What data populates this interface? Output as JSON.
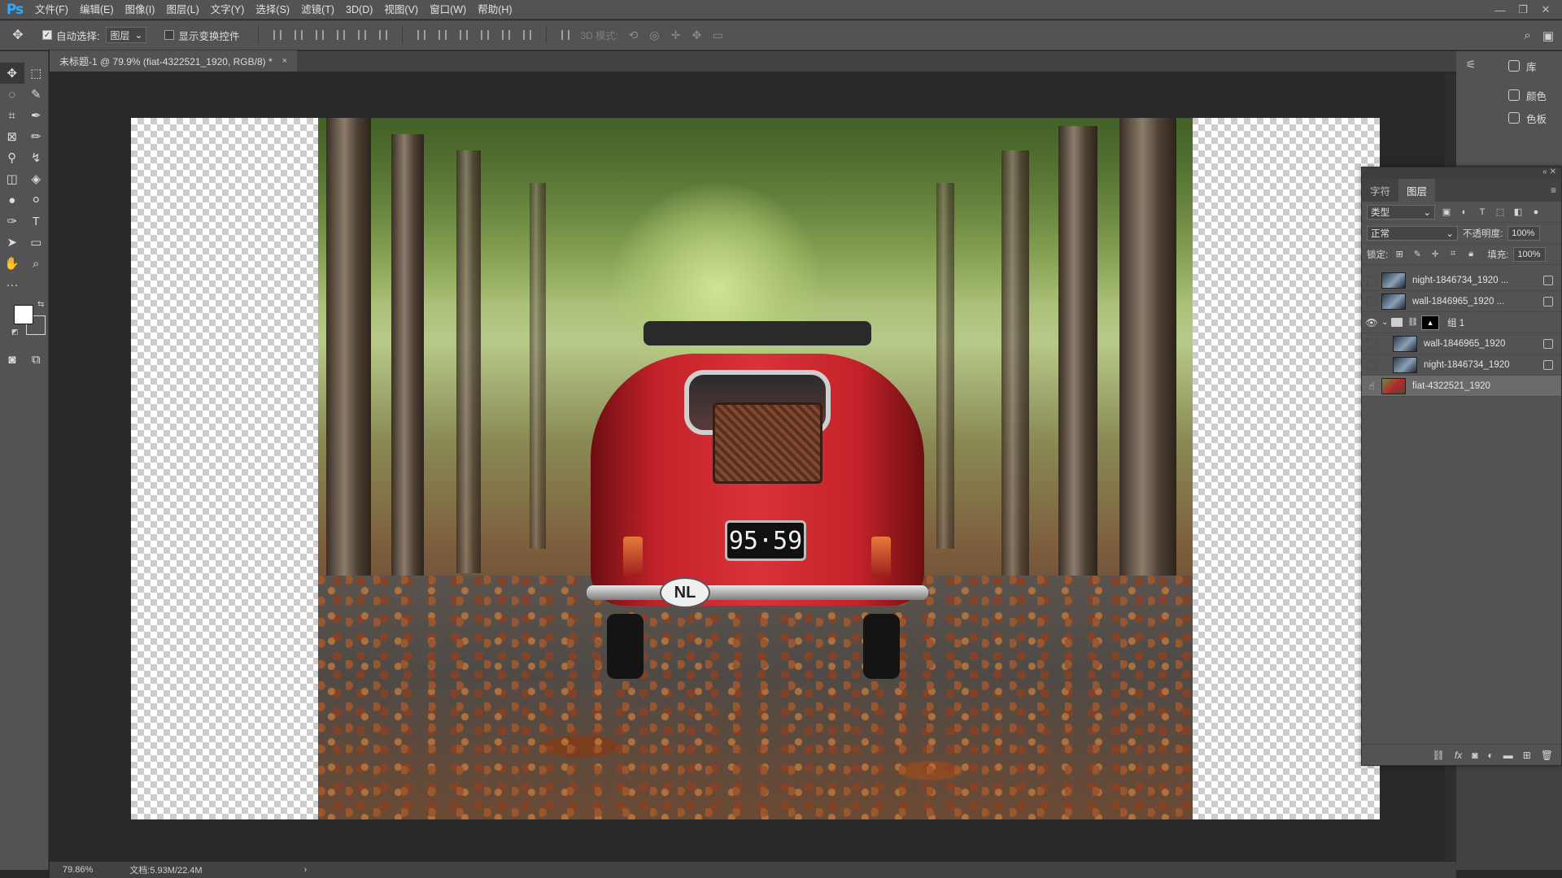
{
  "menubar": {
    "logo": "Ps",
    "items": [
      "文件(F)",
      "编辑(E)",
      "图像(I)",
      "图层(L)",
      "文字(Y)",
      "选择(S)",
      "滤镜(T)",
      "3D(D)",
      "视图(V)",
      "窗口(W)",
      "帮助(H)"
    ],
    "window_controls": [
      "—",
      "❐",
      "✕"
    ]
  },
  "options": {
    "auto_select_label": "自动选择:",
    "auto_select_target": "图层",
    "show_transform_label": "显示变换控件",
    "mode_3d_label": "3D 模式:"
  },
  "document": {
    "tab_title": "未标题-1 @ 79.9% (fiat-4322521_1920, RGB/8) *",
    "plate_text": "95·59",
    "oval_badge": "NL"
  },
  "dock": {
    "library_label": "库",
    "color_label": "颜色",
    "swatches_label": "色板"
  },
  "layers_panel": {
    "tabs": [
      "字符",
      "图层"
    ],
    "filter_kind": "类型",
    "blend_mode": "正常",
    "opacity_label": "不透明度:",
    "opacity_value": "100%",
    "lock_label": "锁定:",
    "fill_label": "填充:",
    "fill_value": "100%",
    "layers": [
      {
        "name": "night-1846734_1920 ...",
        "visible": false,
        "indent": 0,
        "type": "smart"
      },
      {
        "name": "wall-1846965_1920 ...",
        "visible": false,
        "indent": 0,
        "type": "smart"
      },
      {
        "name": "组 1",
        "visible": true,
        "indent": 0,
        "type": "group"
      },
      {
        "name": "wall-1846965_1920",
        "visible": false,
        "indent": 1,
        "type": "smart"
      },
      {
        "name": "night-1846734_1920",
        "visible": false,
        "indent": 1,
        "type": "smart"
      },
      {
        "name": "fiat-4322521_1920",
        "visible": false,
        "indent": 0,
        "type": "smart",
        "selected": true
      }
    ]
  },
  "status": {
    "zoom": "79.86%",
    "doc_size": "文档:5.93M/22.4M"
  }
}
